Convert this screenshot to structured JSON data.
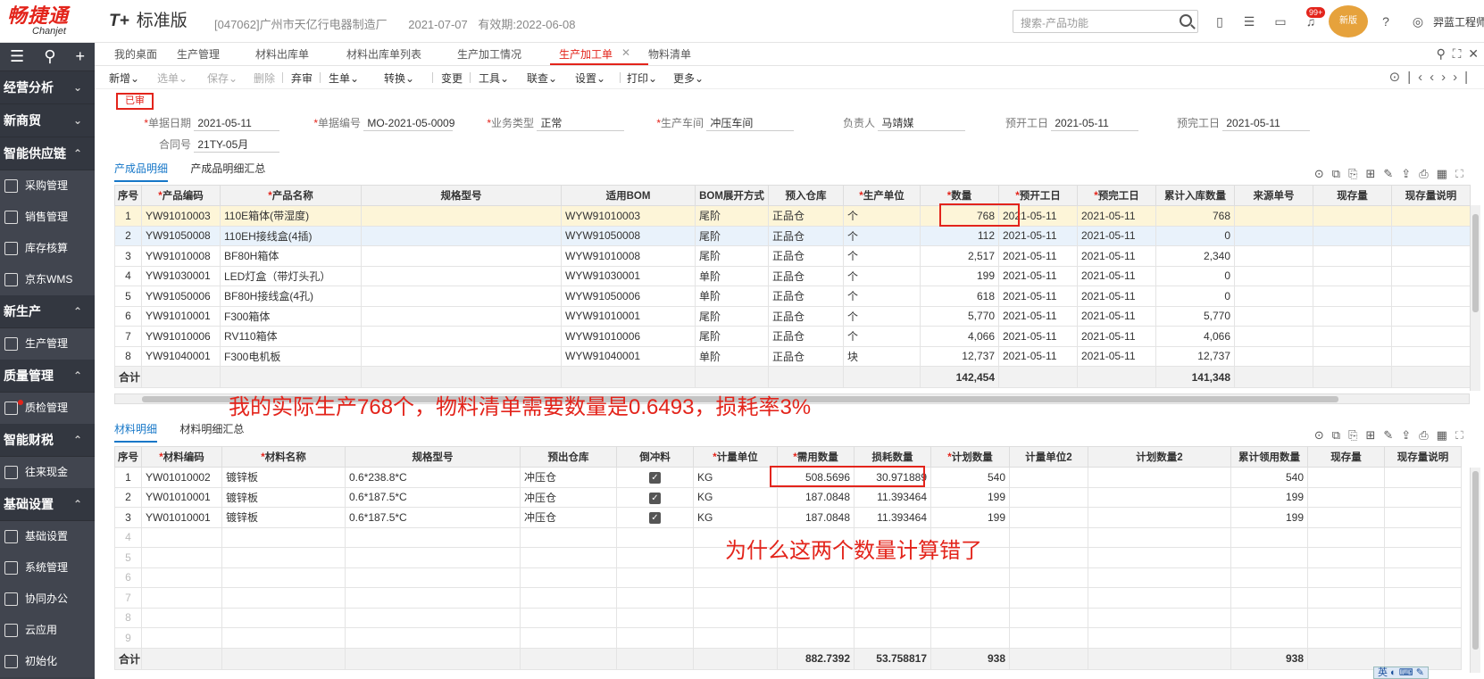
{
  "brand": {
    "cn": "畅捷通",
    "en": "Chanjet",
    "product_prefix": "T+",
    "product_name": "标准版"
  },
  "company": {
    "name": "[047062]广州市天亿行电器制造厂",
    "date": "2021-07-07",
    "expiry": "有效期:2022-06-08"
  },
  "search": {
    "placeholder": "搜索-产品功能"
  },
  "header": {
    "notif_count": "99+",
    "avatar_text": "新版",
    "user": "羿蓝工程师"
  },
  "sidebar": {
    "sections": [
      {
        "label": "经营分析"
      },
      {
        "label": "新商贸"
      },
      {
        "label": "智能供应链"
      },
      {
        "label": "新生产"
      },
      {
        "label": "质量管理"
      },
      {
        "label": "智能财税"
      },
      {
        "label": "基础设置"
      }
    ],
    "items": [
      {
        "label": "采购管理"
      },
      {
        "label": "销售管理"
      },
      {
        "label": "库存核算"
      },
      {
        "label": "京东WMS"
      },
      {
        "label": "生产管理"
      },
      {
        "label": "质检管理"
      },
      {
        "label": "往来现金"
      },
      {
        "label": "基础设置"
      },
      {
        "label": "系统管理"
      },
      {
        "label": "协同办公"
      },
      {
        "label": "云应用"
      },
      {
        "label": "初始化"
      }
    ]
  },
  "tabs": [
    "我的桌面",
    "生产管理",
    "材料出库单",
    "材料出库单列表",
    "生产加工情况",
    "生产加工单",
    "物料清单"
  ],
  "toolbar": [
    "新增",
    "选单",
    "保存",
    "删除",
    "弃审",
    "生单",
    "转换",
    "变更",
    "工具",
    "联查",
    "设置",
    "打印",
    "更多"
  ],
  "status": "已审",
  "form": {
    "doc_date_label": "单据日期",
    "doc_date": "2021-05-11",
    "doc_no_label": "单据编号",
    "doc_no": "MO-2021-05-0009",
    "biz_type_label": "业务类型",
    "biz_type": "正常",
    "workshop_label": "生产车间",
    "workshop": "冲压车间",
    "owner_label": "负责人",
    "owner": "马靖媒",
    "plan_start_label": "预开工日",
    "plan_start": "2021-05-11",
    "plan_end_label": "预完工日",
    "plan_end": "2021-05-11",
    "contract_label": "合同号",
    "contract": "21TY-05月"
  },
  "product_tabs": [
    "产成品明细",
    "产成品明细汇总"
  ],
  "product_table": {
    "columns": [
      "序号",
      "产品编码",
      "产品名称",
      "规格型号",
      "适用BOM",
      "BOM展开方式",
      "预入仓库",
      "生产单位",
      "数量",
      "预开工日",
      "预完工日",
      "累计入库数量",
      "来源单号",
      "现存量",
      "现存量说明"
    ],
    "required": [
      false,
      true,
      true,
      false,
      false,
      false,
      false,
      true,
      true,
      true,
      true,
      false,
      false,
      false,
      false
    ],
    "rows": [
      [
        "1",
        "YW91010003",
        "110E箱体(带湿度)",
        "",
        "WYW91010003",
        "尾阶",
        "正品仓",
        "个",
        "768",
        "2021-05-11",
        "2021-05-11",
        "768",
        "",
        "",
        ""
      ],
      [
        "2",
        "YW91050008",
        "110EH接线盒(4插)",
        "",
        "WYW91050008",
        "尾阶",
        "正品仓",
        "个",
        "112",
        "2021-05-11",
        "2021-05-11",
        "0",
        "",
        "",
        ""
      ],
      [
        "3",
        "YW91010008",
        "BF80H箱体",
        "",
        "WYW91010008",
        "尾阶",
        "正品仓",
        "个",
        "2,517",
        "2021-05-11",
        "2021-05-11",
        "2,340",
        "",
        "",
        ""
      ],
      [
        "4",
        "YW91030001",
        "LED灯盒（带灯头孔）",
        "",
        "WYW91030001",
        "单阶",
        "正品仓",
        "个",
        "199",
        "2021-05-11",
        "2021-05-11",
        "0",
        "",
        "",
        ""
      ],
      [
        "5",
        "YW91050006",
        "BF80H接线盒(4孔)",
        "",
        "WYW91050006",
        "单阶",
        "正品仓",
        "个",
        "618",
        "2021-05-11",
        "2021-05-11",
        "0",
        "",
        "",
        ""
      ],
      [
        "6",
        "YW91010001",
        "F300箱体",
        "",
        "WYW91010001",
        "尾阶",
        "正品仓",
        "个",
        "5,770",
        "2021-05-11",
        "2021-05-11",
        "5,770",
        "",
        "",
        ""
      ],
      [
        "7",
        "YW91010006",
        "RV110箱体",
        "",
        "WYW91010006",
        "尾阶",
        "正品仓",
        "个",
        "4,066",
        "2021-05-11",
        "2021-05-11",
        "4,066",
        "",
        "",
        ""
      ],
      [
        "8",
        "YW91040001",
        "F300电机板",
        "",
        "WYW91040001",
        "单阶",
        "正品仓",
        "块",
        "12,737",
        "2021-05-11",
        "2021-05-11",
        "12,737",
        "",
        "",
        ""
      ]
    ],
    "total_label": "合计",
    "total_qty": "142,454",
    "total_in": "141,348"
  },
  "annotation_top": "我的实际生产768个，物料清单需要数量是0.6493，损耗率3%",
  "material_tabs": [
    "材料明细",
    "材料明细汇总"
  ],
  "material_table": {
    "columns": [
      "序号",
      "材料编码",
      "材料名称",
      "规格型号",
      "预出仓库",
      "倒冲料",
      "计量单位",
      "需用数量",
      "损耗数量",
      "计划数量",
      "计量单位2",
      "计划数量2",
      "累计领用数量",
      "现存量",
      "现存量说明"
    ],
    "required": [
      false,
      true,
      true,
      false,
      false,
      false,
      true,
      true,
      false,
      true,
      false,
      false,
      false,
      false,
      false
    ],
    "rows": [
      [
        "1",
        "YW01010002",
        "镀锌板",
        "0.6*238.8*C",
        "冲压仓",
        "✓",
        "KG",
        "508.5696",
        "30.971889",
        "540",
        "",
        "",
        "540",
        "",
        ""
      ],
      [
        "2",
        "YW01010001",
        "镀锌板",
        "0.6*187.5*C",
        "冲压仓",
        "✓",
        "KG",
        "187.0848",
        "11.393464",
        "199",
        "",
        "",
        "199",
        "",
        ""
      ],
      [
        "3",
        "YW01010001",
        "镀锌板",
        "0.6*187.5*C",
        "冲压仓",
        "✓",
        "KG",
        "187.0848",
        "11.393464",
        "199",
        "",
        "",
        "199",
        "",
        ""
      ],
      [
        "4",
        "",
        "",
        "",
        "",
        "",
        "",
        "",
        "",
        "",
        "",
        "",
        "",
        "",
        ""
      ],
      [
        "5",
        "",
        "",
        "",
        "",
        "",
        "",
        "",
        "",
        "",
        "",
        "",
        "",
        "",
        ""
      ],
      [
        "6",
        "",
        "",
        "",
        "",
        "",
        "",
        "",
        "",
        "",
        "",
        "",
        "",
        "",
        ""
      ],
      [
        "7",
        "",
        "",
        "",
        "",
        "",
        "",
        "",
        "",
        "",
        "",
        "",
        "",
        "",
        ""
      ],
      [
        "8",
        "",
        "",
        "",
        "",
        "",
        "",
        "",
        "",
        "",
        "",
        "",
        "",
        "",
        ""
      ],
      [
        "9",
        "",
        "",
        "",
        "",
        "",
        "",
        "",
        "",
        "",
        "",
        "",
        "",
        "",
        ""
      ]
    ],
    "total_label": "合计",
    "total_need": "882.7392",
    "total_loss": "53.758817",
    "total_plan": "938",
    "total_used": "938"
  },
  "annotation_bottom": "为什么这两个数量计算错了",
  "ime": "英"
}
